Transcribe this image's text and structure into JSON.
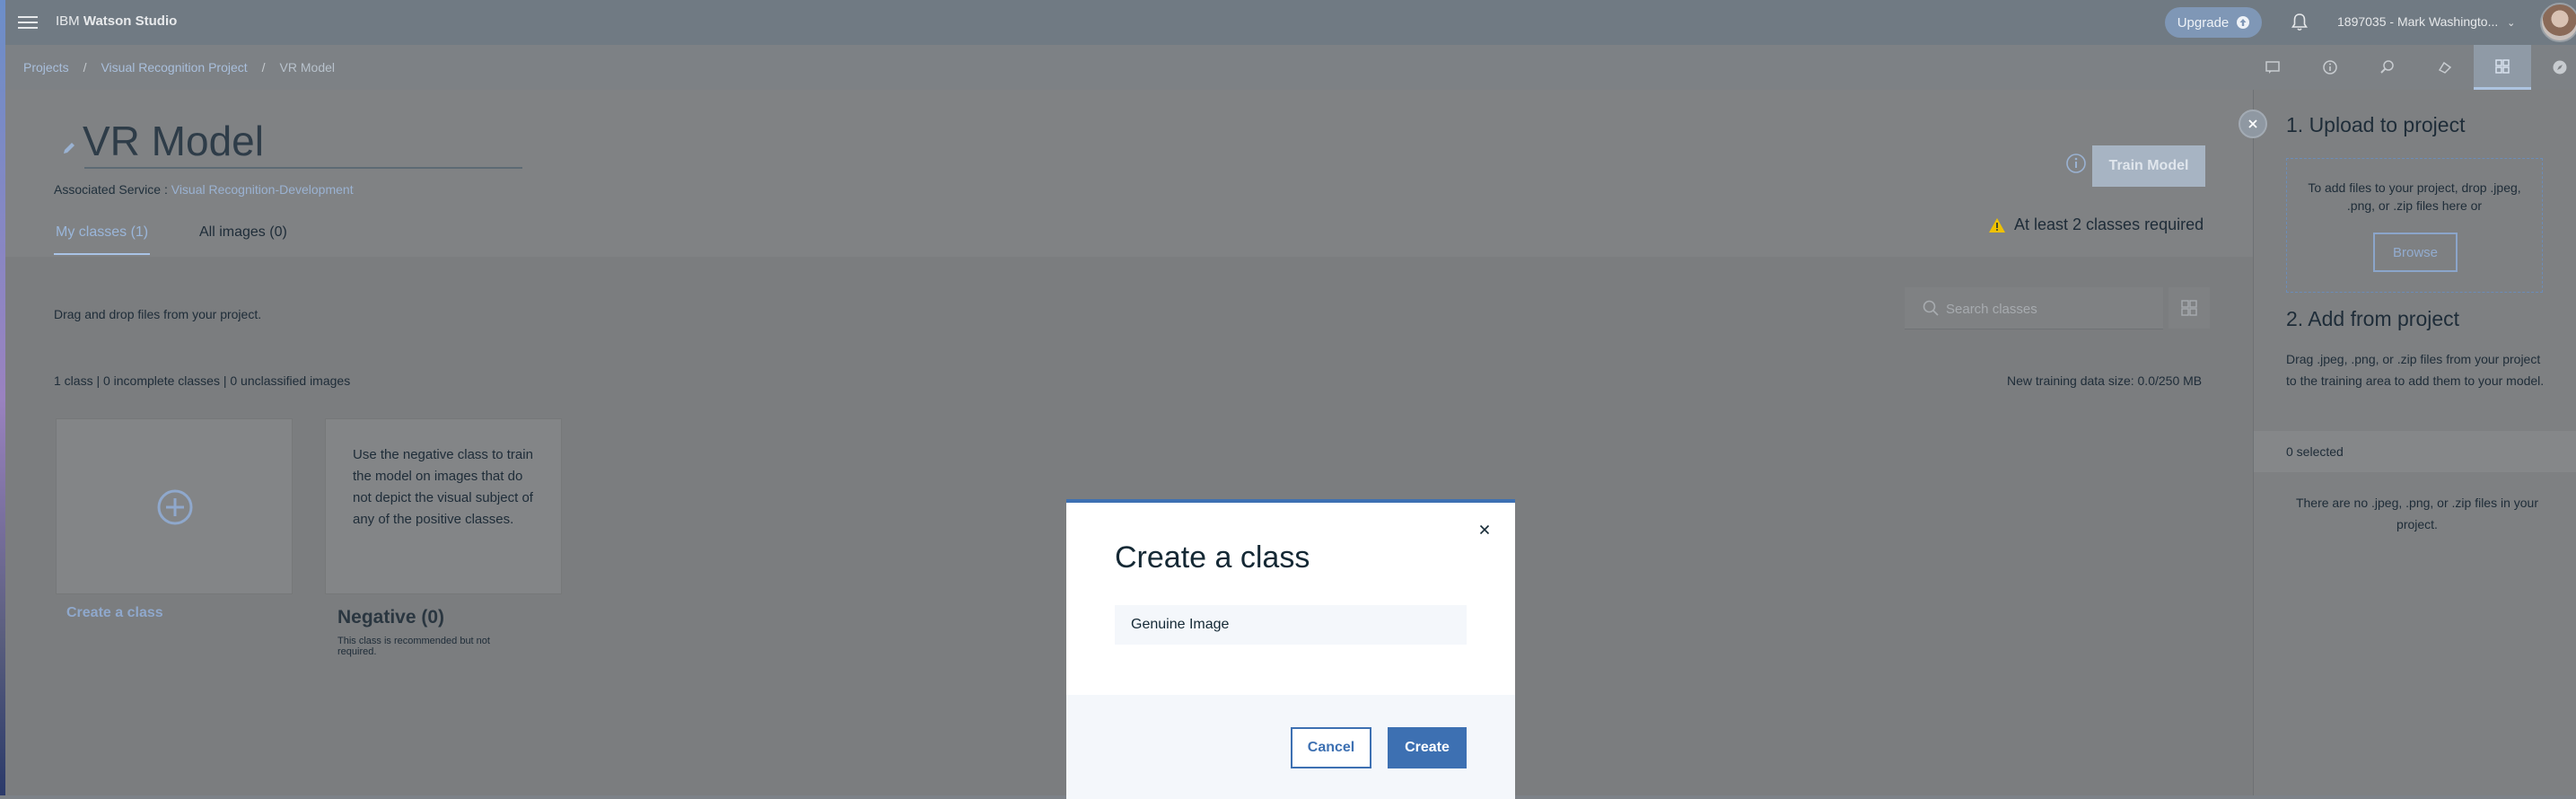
{
  "app": {
    "brand_prefix": "IBM",
    "brand_name": "Watson Studio"
  },
  "header": {
    "upgrade_label": "Upgrade",
    "account_label": "1897035 - Mark Washingto..."
  },
  "breadcrumb": {
    "items": [
      "Projects",
      "Visual Recognition Project",
      "VR Model"
    ]
  },
  "toolbar": {
    "icons": [
      "comment-icon",
      "info-icon",
      "search-icon",
      "cluster-icon",
      "grid-icon",
      "compass-icon"
    ],
    "active_index": 4
  },
  "model": {
    "title": "VR Model",
    "assoc_label": "Associated Service :",
    "assoc_link": "Visual Recognition-Development",
    "train_label": "Train Model",
    "warning": "At least 2 classes required"
  },
  "tabs": [
    {
      "label": "My classes (1)",
      "active": true
    },
    {
      "label": "All images (0)",
      "active": false
    }
  ],
  "workspace": {
    "drag_hint": "Drag and drop files from your project.",
    "search_placeholder": "Search classes",
    "counts": "1 class | 0 incomplete classes | 0 unclassified images",
    "data_size": "New training data size: 0.0/250 MB"
  },
  "cards": {
    "create_caption": "Create a class",
    "negative_text": "Use the negative class to train the model on images that do not depict the visual subject of any of the positive classes.",
    "negative_title": "Negative (0)",
    "negative_note": "This class is recommended but not required."
  },
  "panel": {
    "upload_title": "1. Upload to project",
    "drop_text": "To add files to your project, drop .jpeg, .png, or .zip files here or",
    "browse_label": "Browse",
    "add_title": "2. Add from project",
    "add_text": "Drag .jpeg, .png, or .zip files from your project to the training area to add them to your model.",
    "selected": "0 selected",
    "empty": "There are no .jpeg, .png, or .zip files in your project."
  },
  "modal": {
    "title": "Create a class",
    "input_value": "Genuine Image",
    "cancel_label": "Cancel",
    "create_label": "Create"
  },
  "colors": {
    "primary": "#3d70b2",
    "link": "#9ab2d2",
    "warning": "#efc100"
  }
}
